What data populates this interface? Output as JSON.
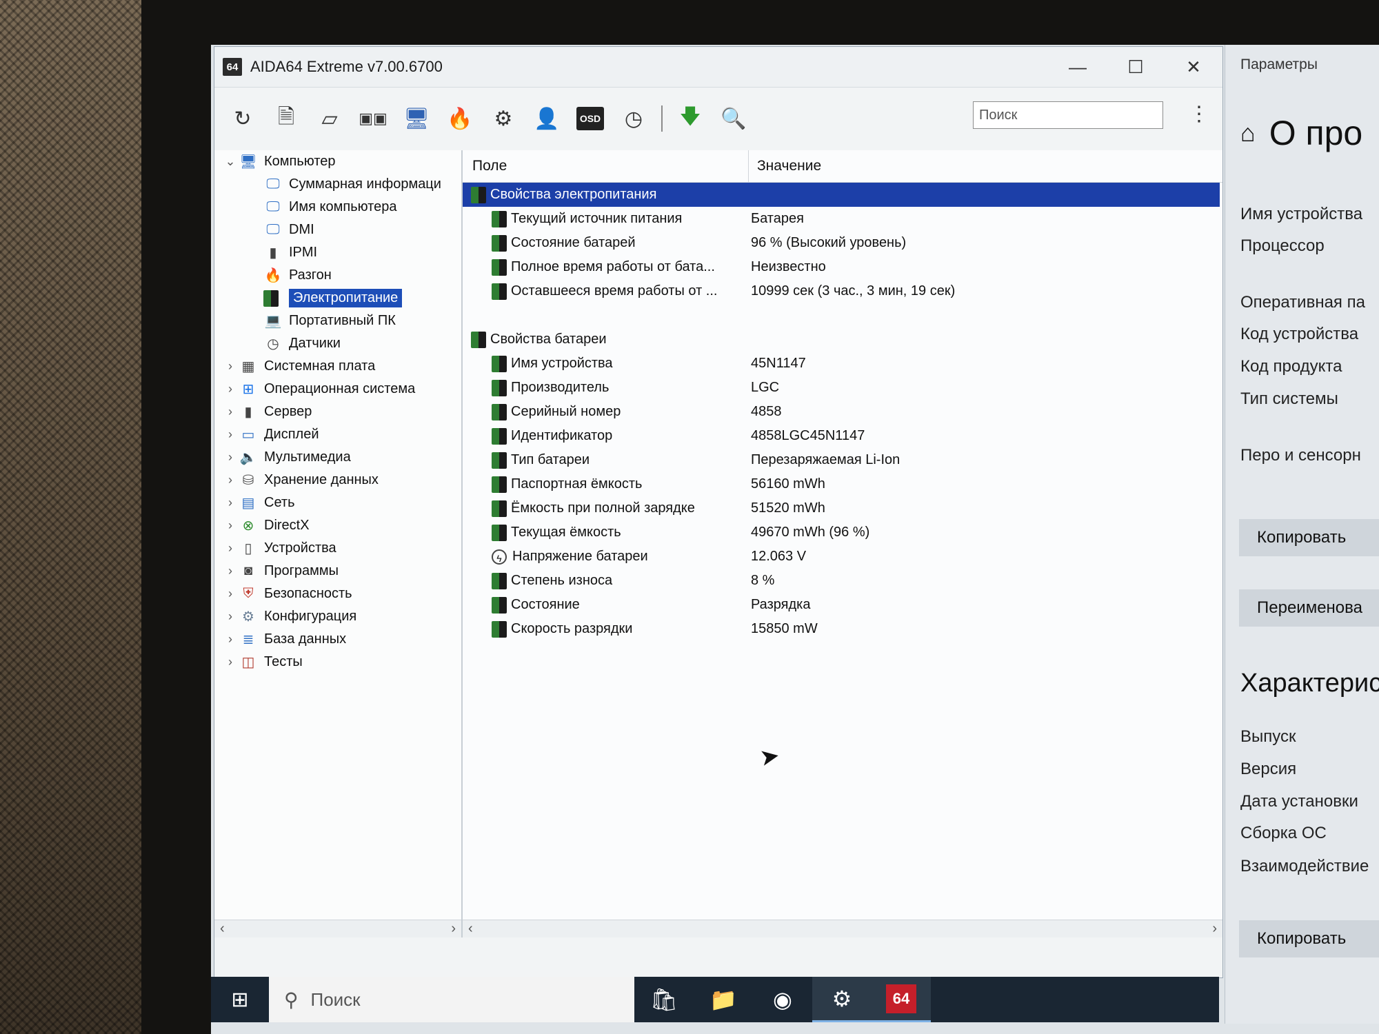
{
  "window": {
    "title": "AIDA64 Extreme v7.00.6700",
    "app_icon": "64",
    "controls": [
      "minimize-icon",
      "maximize-icon",
      "close-icon"
    ]
  },
  "toolbar": {
    "icons": [
      "refresh-icon",
      "report-icon",
      "motherboard-icon",
      "memory-icon",
      "network-icon",
      "flame-icon",
      "tasks-icon",
      "user-icon",
      "osd-icon",
      "gauge-icon",
      "download-icon",
      "search-icon"
    ],
    "osd_label": "OSD",
    "search_placeholder": "Поиск"
  },
  "tree": {
    "items": [
      {
        "label": "Компьютер",
        "level": 0,
        "expanded": true,
        "icon": "computer-icon"
      },
      {
        "label": "Суммарная информаци",
        "level": 1,
        "icon": "monitor-icon"
      },
      {
        "label": "Имя компьютера",
        "level": 1,
        "icon": "monitor-icon"
      },
      {
        "label": "DMI",
        "level": 1,
        "icon": "monitor-icon"
      },
      {
        "label": "IPMI",
        "level": 1,
        "icon": "server-icon"
      },
      {
        "label": "Разгон",
        "level": 1,
        "icon": "flame-icon"
      },
      {
        "label": "Электропитание",
        "level": 1,
        "icon": "battery-icon",
        "selected": true
      },
      {
        "label": "Портативный ПК",
        "level": 1,
        "icon": "laptop-icon"
      },
      {
        "label": "Датчики",
        "level": 1,
        "icon": "gauge-icon"
      },
      {
        "label": "Системная плата",
        "level": 0,
        "icon": "motherboard-icon"
      },
      {
        "label": "Операционная система",
        "level": 0,
        "icon": "windows-icon"
      },
      {
        "label": "Сервер",
        "level": 0,
        "icon": "server-icon"
      },
      {
        "label": "Дисплей",
        "level": 0,
        "icon": "display-icon"
      },
      {
        "label": "Мультимедиа",
        "level": 0,
        "icon": "speaker-icon"
      },
      {
        "label": "Хранение данных",
        "level": 0,
        "icon": "storage-icon"
      },
      {
        "label": "Сеть",
        "level": 0,
        "icon": "network-icon"
      },
      {
        "label": "DirectX",
        "level": 0,
        "icon": "xbox-icon"
      },
      {
        "label": "Устройства",
        "level": 0,
        "icon": "device-icon"
      },
      {
        "label": "Программы",
        "level": 0,
        "icon": "programs-icon"
      },
      {
        "label": "Безопасность",
        "level": 0,
        "icon": "shield-icon"
      },
      {
        "label": "Конфигурация",
        "level": 0,
        "icon": "config-icon"
      },
      {
        "label": "База данных",
        "level": 0,
        "icon": "database-icon"
      },
      {
        "label": "Тесты",
        "level": 0,
        "icon": "benchmark-icon"
      }
    ]
  },
  "table": {
    "col_field": "Поле",
    "col_value": "Значение",
    "groups": [
      {
        "title": "Свойства электропитания",
        "highlight": true,
        "rows": [
          {
            "field": "Текущий источник питания",
            "value": "Батарея"
          },
          {
            "field": "Состояние батарей",
            "value": "96 % (Высокий уровень)"
          },
          {
            "field": "Полное время работы от бата...",
            "value": "Неизвестно"
          },
          {
            "field": "Оставшееся время работы от ...",
            "value": "10999 сек (3 час., 3 мин, 19 сек)"
          }
        ]
      },
      {
        "title": "Свойства батареи",
        "highlight": false,
        "rows": [
          {
            "field": "Имя устройства",
            "value": "45N1147"
          },
          {
            "field": "Производитель",
            "value": "LGC"
          },
          {
            "field": "Серийный номер",
            "value": "4858"
          },
          {
            "field": "Идентификатор",
            "value": "4858LGC45N1147"
          },
          {
            "field": "Тип батареи",
            "value": "Перезаряжаемая Li-Ion"
          },
          {
            "field": "Паспортная ёмкость",
            "value": "56160 mWh"
          },
          {
            "field": "Ёмкость при полной зарядке",
            "value": "51520 mWh"
          },
          {
            "field": "Текущая ёмкость",
            "value": "49670 mWh  (96 %)"
          },
          {
            "field": "Напряжение батареи",
            "value": "12.063 V",
            "icon": "voltage-icon"
          },
          {
            "field": "Степень износа",
            "value": "8 %"
          },
          {
            "field": "Состояние",
            "value": "Разрядка"
          },
          {
            "field": "Скорость разрядки",
            "value": "15850 mW"
          }
        ]
      }
    ]
  },
  "taskbar": {
    "search_placeholder": "Поиск",
    "apps": [
      "store-icon",
      "explorer-icon",
      "chrome-icon",
      "settings-icon",
      "aida64-icon"
    ],
    "aida_label": "64"
  },
  "settings": {
    "header": "Параметры",
    "title": "О про",
    "labels": [
      "Имя устройства",
      "Процессор",
      "Оперативная па",
      "Код устройства",
      "Код продукта",
      "Тип системы",
      "Перо и сенсорн"
    ],
    "copy_button": "Копировать",
    "rename_button": "Переименова",
    "section_title": "Характерис",
    "spec_labels": [
      "Выпуск",
      "Версия",
      "Дата установки",
      "Сборка ОС",
      "Взаимодействие"
    ],
    "copy_button_2": "Копировать"
  }
}
